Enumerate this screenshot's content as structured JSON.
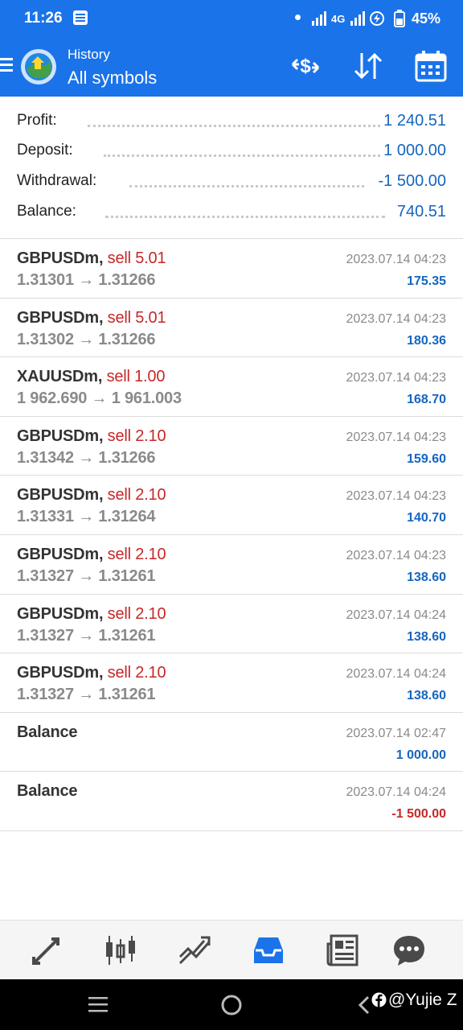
{
  "status_bar": {
    "time": "11:26",
    "network": "4G",
    "battery": "45%"
  },
  "header": {
    "subtitle": "History",
    "title": "All symbols"
  },
  "summary": [
    {
      "label": "Profit:",
      "value": "1 240.51"
    },
    {
      "label": "Deposit:",
      "value": "1 000.00"
    },
    {
      "label": "Withdrawal:",
      "value": "-1 500.00"
    },
    {
      "label": "Balance:",
      "value": "740.51"
    }
  ],
  "deals": [
    {
      "symbol": "GBPUSDm,",
      "side": "sell 5.01",
      "prices": "1.31301 → 1.31266",
      "time": "2023.07.14 04:23",
      "profit": "175.35"
    },
    {
      "symbol": "GBPUSDm,",
      "side": "sell 5.01",
      "prices": "1.31302 → 1.31266",
      "time": "2023.07.14 04:23",
      "profit": "180.36"
    },
    {
      "symbol": "XAUUSDm,",
      "side": "sell 1.00",
      "prices": "1 962.690 → 1 961.003",
      "time": "2023.07.14 04:23",
      "profit": "168.70"
    },
    {
      "symbol": "GBPUSDm,",
      "side": "sell 2.10",
      "prices": "1.31342 → 1.31266",
      "time": "2023.07.14 04:23",
      "profit": "159.60"
    },
    {
      "symbol": "GBPUSDm,",
      "side": "sell 2.10",
      "prices": "1.31331 → 1.31264",
      "time": "2023.07.14 04:23",
      "profit": "140.70"
    },
    {
      "symbol": "GBPUSDm,",
      "side": "sell 2.10",
      "prices": "1.31327 → 1.31261",
      "time": "2023.07.14 04:23",
      "profit": "138.60"
    },
    {
      "symbol": "GBPUSDm,",
      "side": "sell 2.10",
      "prices": "1.31327 → 1.31261",
      "time": "2023.07.14 04:24",
      "profit": "138.60"
    },
    {
      "symbol": "GBPUSDm,",
      "side": "sell 2.10",
      "prices": "1.31327 → 1.31261",
      "time": "2023.07.14 04:24",
      "profit": "138.60"
    }
  ],
  "balance_ops": [
    {
      "label": "Balance",
      "time": "2023.07.14 02:47",
      "amount": "1 000.00"
    },
    {
      "label": "Balance",
      "time": "2023.07.14 04:24",
      "amount": "-1 500.00"
    }
  ],
  "bottom_nav": [
    {
      "name": "quotes-icon"
    },
    {
      "name": "chart-icon"
    },
    {
      "name": "trade-icon"
    },
    {
      "name": "history-icon",
      "active": true
    },
    {
      "name": "news-icon"
    },
    {
      "name": "messages-icon"
    }
  ],
  "watermark": "@Yujie Z",
  "colors": {
    "accent": "#1a73e8",
    "positive": "#1565c0",
    "negative": "#c62828",
    "nav_inactive": "#4a4a4a"
  }
}
